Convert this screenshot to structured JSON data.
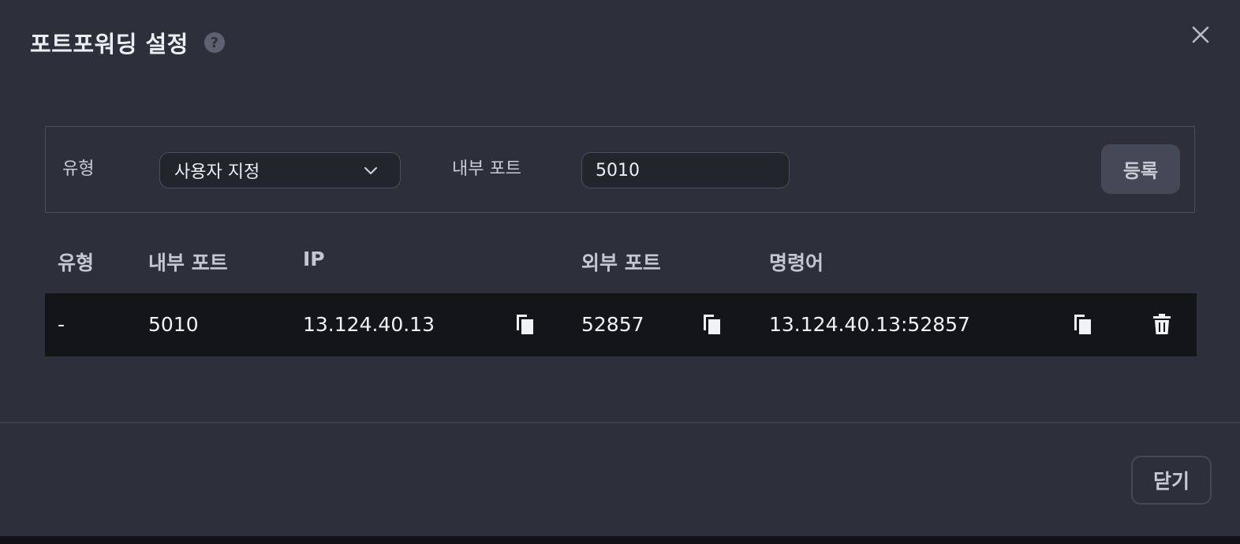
{
  "dialog": {
    "title": "포트포워딩 설정",
    "help_glyph": "?",
    "icons": {
      "help": "question-circle-icon",
      "close": "close-icon"
    }
  },
  "form": {
    "type_label": "유형",
    "type_value": "사용자 지정",
    "internal_port_label": "내부 포트",
    "internal_port_value": "5010",
    "register_label": "등록"
  },
  "table": {
    "headers": [
      "유형",
      "내부 포트",
      "IP",
      "외부 포트",
      "명령어"
    ],
    "rows": [
      {
        "type": "-",
        "internal_port": "5010",
        "ip": "13.124.40.13",
        "external_port": "52857",
        "command": "13.124.40.13:52857"
      }
    ]
  },
  "footer": {
    "close_label": "닫기"
  },
  "colors": {
    "background": "#2d303a",
    "row_background": "#141518",
    "button": "#454955"
  }
}
